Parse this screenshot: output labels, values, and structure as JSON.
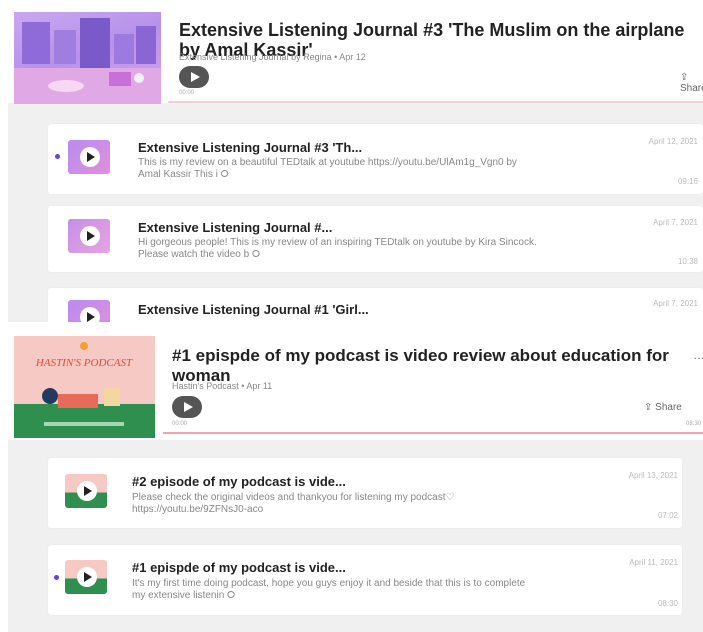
{
  "panels": [
    {
      "title": "Extensive Listening Journal #3 'The Muslim on the airplane by Amal Kassir'",
      "subtitle": "Extensive Listening Journal by Regina • Apr 12",
      "share_label": "Share",
      "time_left": "00:00",
      "episodes": [
        {
          "title": "Extensive Listening Journal #3 'Th...",
          "desc": "This is my review on a beautiful TEDtalk at youtube https://youtu.be/UlAm1g_Vgn0 by Amal Kassir This i ⭘",
          "date": "April 12, 2021",
          "duration": "09:16"
        },
        {
          "title": "Extensive Listening Journal #...",
          "desc": "Hi gorgeous people! This is my review of an inspiring TEDtalk on youtube by Kira Sincock. Please watch the video b ⭘",
          "date": "April 7, 2021",
          "duration": "10:38"
        },
        {
          "title": "Extensive Listening Journal #1 'Girl...",
          "desc": "",
          "date": "April 7, 2021",
          "duration": ""
        }
      ]
    },
    {
      "title": "#1 epispde of my podcast is video review about education for woman",
      "subtitle": "Hastin's Podcast • Apr 11",
      "share_label": "Share",
      "time_left": "00:00",
      "time_right": "08:30",
      "cover_text": "HASTIN'S PODCAST",
      "episodes": [
        {
          "title": "#2 episode of my podcast is vide...",
          "desc": "Please check the original videos and thankyou for listening my podcast♡ https://youtu.be/9ZFNsJ0-aco",
          "date": "April 13, 2021",
          "duration": "07:02"
        },
        {
          "title": "#1 epispde of my podcast is vide...",
          "desc": "It's my first time doing podcast, hope you guys enjoy it and beside that this is to complete my extensive listenin ⭘",
          "date": "April 11, 2021",
          "duration": "08:30"
        }
      ]
    }
  ],
  "colors": {
    "accent_purple": "#6b3fe8",
    "progress_pink": "#f4a3ad"
  }
}
